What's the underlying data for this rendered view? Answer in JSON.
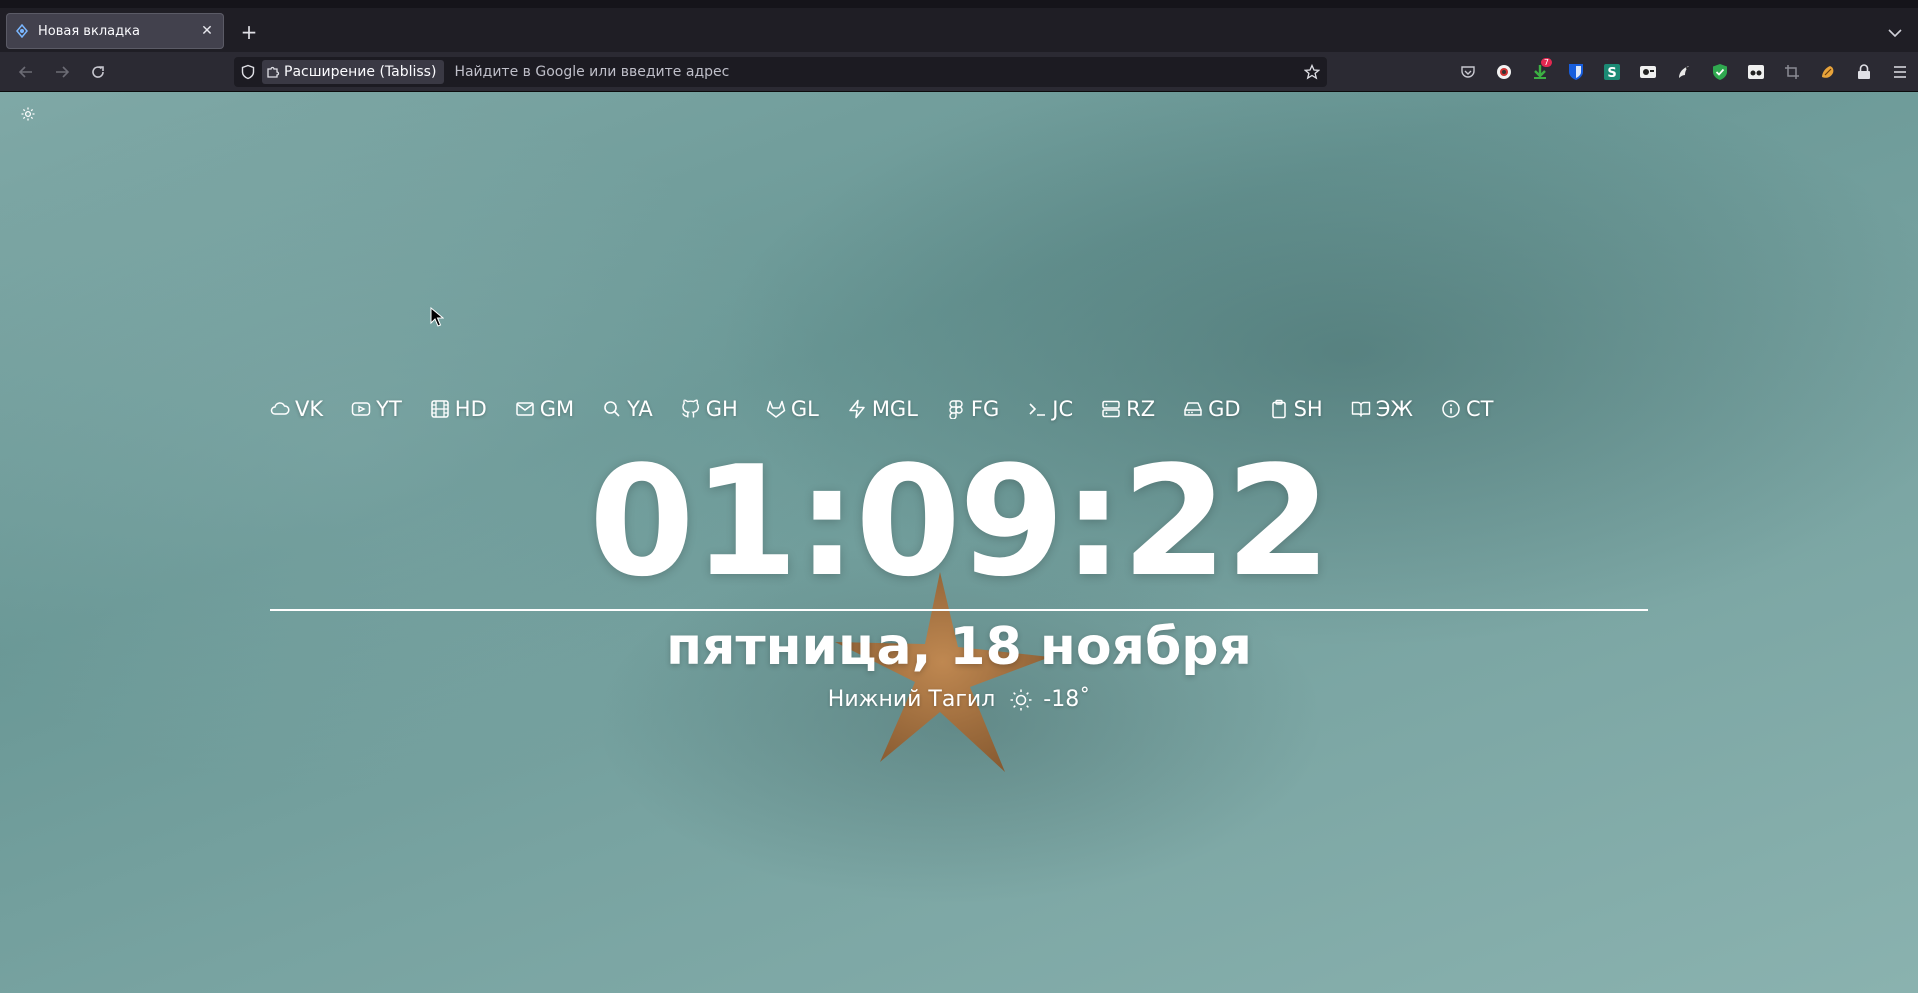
{
  "browser": {
    "tab": {
      "title": "Новая вкладка",
      "close_label": "✕"
    },
    "new_tab_label": "+",
    "urlbar": {
      "identity_label": "Расширение (Tabliss)",
      "placeholder": "Найдите в Google или введите адрес",
      "value": ""
    },
    "extensions": [
      {
        "name": "pocket-icon"
      },
      {
        "name": "globe-extension-icon"
      },
      {
        "name": "download-extension-icon",
        "badge": "7"
      },
      {
        "name": "bitwarden-icon"
      },
      {
        "name": "s-extension-icon"
      },
      {
        "name": "camera-extension-icon"
      },
      {
        "name": "bird-extension-icon"
      },
      {
        "name": "shield-check-icon"
      },
      {
        "name": "reader-extension-icon"
      },
      {
        "name": "crop-extension-icon"
      },
      {
        "name": "hand-extension-icon"
      },
      {
        "name": "lock-extension-icon"
      },
      {
        "name": "menu-icon"
      }
    ]
  },
  "links": [
    {
      "icon": "cloud-icon",
      "label": "VK"
    },
    {
      "icon": "youtube-icon",
      "label": "YT"
    },
    {
      "icon": "film-icon",
      "label": "HD"
    },
    {
      "icon": "mail-icon",
      "label": "GM"
    },
    {
      "icon": "search-icon",
      "label": "YA"
    },
    {
      "icon": "github-icon",
      "label": "GH"
    },
    {
      "icon": "gitlab-icon",
      "label": "GL"
    },
    {
      "icon": "zap-icon",
      "label": "MGL"
    },
    {
      "icon": "figma-icon",
      "label": "FG"
    },
    {
      "icon": "terminal-icon",
      "label": "JC"
    },
    {
      "icon": "server-icon",
      "label": "RZ"
    },
    {
      "icon": "hard-drive-icon",
      "label": "GD"
    },
    {
      "icon": "clipboard-icon",
      "label": "SH"
    },
    {
      "icon": "book-open-icon",
      "label": "ЭЖ"
    },
    {
      "icon": "info-icon",
      "label": "CT"
    }
  ],
  "clock": {
    "time": "01:09:22"
  },
  "date": {
    "text": "пятница, 18 ноября"
  },
  "weather": {
    "city": "Нижний Тагил",
    "icon": "sun-icon",
    "temperature": "-18˚"
  },
  "colors": {
    "chrome_bg": "#2b2a33",
    "tab_bg": "#42414d",
    "urlbar_bg": "#1c1b22",
    "text": "#ffffff"
  }
}
